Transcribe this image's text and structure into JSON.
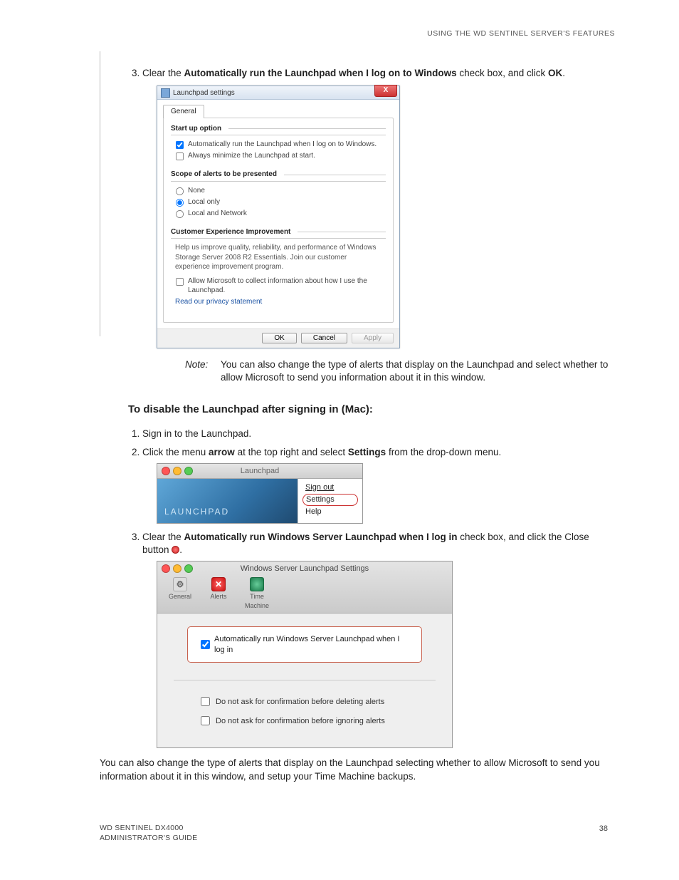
{
  "header": "USING THE WD SENTINEL SERVER'S FEATURES",
  "step3_intro": {
    "prefix": "Clear the ",
    "bold": "Automatically run the Launchpad when I log on to Windows",
    "mid": " check box, and click ",
    "bold2": "OK",
    "suffix": "."
  },
  "win": {
    "title": "Launchpad settings",
    "close": "X",
    "tab": "General",
    "groups": {
      "startup": {
        "title": "Start up option",
        "opt1": "Automatically run the Launchpad when I log on to Windows.",
        "opt2": "Always minimize the Launchpad at start."
      },
      "scope": {
        "title": "Scope of alerts to be presented",
        "o1": "None",
        "o2": "Local only",
        "o3": "Local and Network"
      },
      "cei": {
        "title": "Customer Experience Improvement",
        "desc": "Help us improve quality, reliability, and performance of Windows Storage Server 2008 R2 Essentials. Join our customer experience improvement program.",
        "opt": "Allow Microsoft to collect information about how I use the Launchpad.",
        "link": "Read our privacy statement"
      }
    },
    "buttons": {
      "ok": "OK",
      "cancel": "Cancel",
      "apply": "Apply"
    }
  },
  "note": {
    "label": "Note:",
    "text": "You can also change the type of alerts that display on the Launchpad and select whether to allow Microsoft to send you information about it in this window."
  },
  "mac_heading": "To disable the Launchpad after signing in (Mac):",
  "mac_step1": "Sign in to the Launchpad.",
  "mac_step2": {
    "p1": "Click the menu ",
    "b1": "arrow",
    "p2": " at the top right and select ",
    "b2": "Settings",
    "p3": " from the drop-down menu."
  },
  "mac_mini": {
    "title": "Launchpad",
    "hero": "LAUNCHPAD",
    "menu": {
      "signout": "Sign out",
      "settings": "Settings",
      "help": "Help"
    }
  },
  "mac_step3": {
    "p1": "Clear the ",
    "b1": "Automatically run Windows Server Launchpad when I log in",
    "p2": " check box, and click the Close button "
  },
  "mac_dialog": {
    "title": "Windows Server Launchpad Settings",
    "tabs": {
      "general": "General",
      "alerts": "Alerts",
      "tm": "Time Machine"
    },
    "chk_main": "Automatically run Windows Server Launchpad when I log in",
    "chk_del": "Do not ask for confirmation before deleting alerts",
    "chk_ign": "Do not ask for confirmation before ignoring alerts"
  },
  "closing_para": "You can also change the type of alerts that display on the Launchpad selecting whether to allow Microsoft to send you information about it in this window, and setup your Time Machine backups.",
  "footer": {
    "l1": "WD SENTINEL DX4000",
    "l2": "ADMINISTRATOR'S GUIDE",
    "page": "38"
  }
}
